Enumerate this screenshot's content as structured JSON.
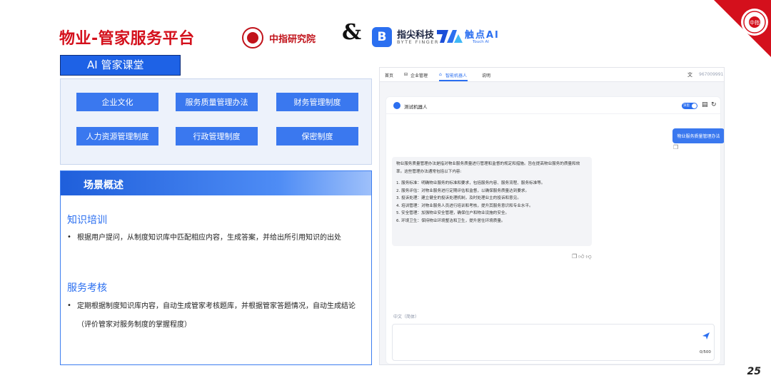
{
  "header": {
    "title": "物业-管家服务平台",
    "partner1_name": "中指研究院",
    "amp": "&",
    "partner2_logo_glyph": "B",
    "partner2_cn": "指尖科技",
    "partner2_en": "BYTE FINGER",
    "partner3_cn": "触点AI",
    "partner3_en": "Touch AI",
    "corner_seal_text": "中指"
  },
  "classroom": {
    "tab_label": "AI 管家课堂",
    "topics": [
      "企业文化",
      "服务质量管理办法",
      "财务管理制度",
      "人力资源管理制度",
      "行政管理制度",
      "保密制度"
    ]
  },
  "scene": {
    "title": "场景概述",
    "sections": [
      {
        "title": "知识培训",
        "bullet": "根据用户提问，从制度知识库中匹配相应内容，生成答案，并给出所引用知识的出处"
      },
      {
        "title": "服务考核",
        "bullet": "定期根据制度知识库内容，自动生成管家考核题库，并根据管家答题情况，自动生成结论（评价管家对服务制度的掌握程度）"
      }
    ]
  },
  "app": {
    "nav": [
      "首页",
      "企业管理",
      "智能机器人",
      "说明"
    ],
    "active_nav": "智能机器人",
    "account": "967009991",
    "robot_name": "测试机器人",
    "toggle_label": "深思",
    "user_message": "物业服务质量管理办法",
    "bot_intro": "物业服务质量管理办法是指对物业服务质量进行管理和监督的规定和措施。旨在提高物业服务的质量和效率。这些管理办法通常包括以下内容:",
    "bot_items": [
      "1. 服务标准：明确物业服务的标准和要求，包括服务内容、服务流程、服务标准等。",
      "2. 服务评估：对物业服务进行定期评估和监督，以确保服务质量达到要求。",
      "3. 投诉处理：建立健全的投诉处理机制，及时处理业主的投诉和意见。",
      "4. 培训管理：对物业服务人员进行培训和考核，提升其服务意识和专业水平。",
      "5. 安全管理：加强物业安全管理，确保住户和物业设施的安全。",
      "6. 环境卫生：保持物业环境整洁和卫生，提升居住环境质量。"
    ],
    "lang_label": "中文（简体）",
    "char_count": "0/500"
  },
  "page_number": "25",
  "colors": {
    "brand_red": "#d4101c",
    "accent_blue": "#2b6ff0",
    "topic_button": "#3a78ef"
  }
}
